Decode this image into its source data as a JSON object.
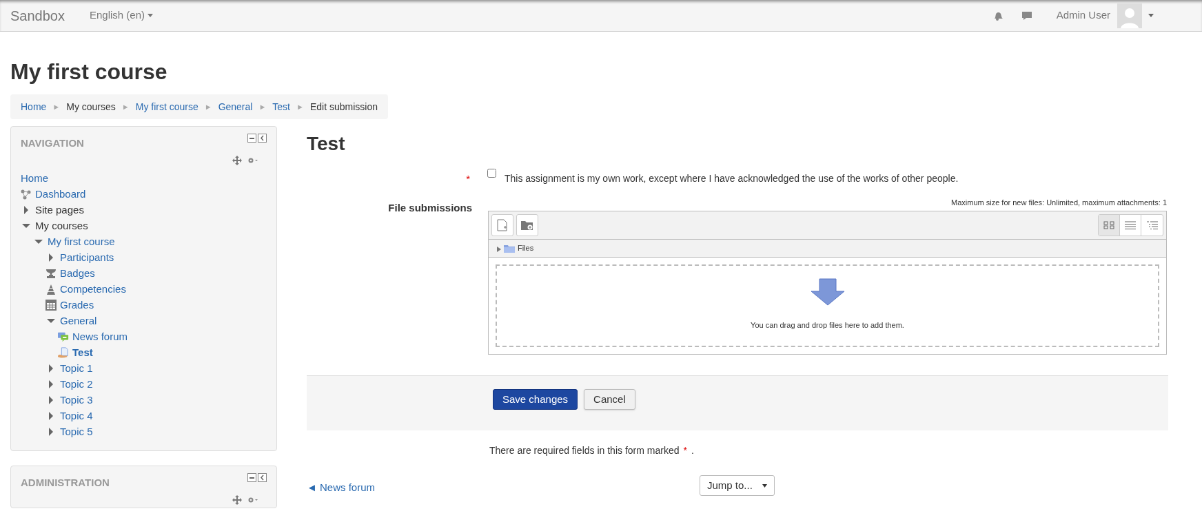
{
  "navbar": {
    "brand": "Sandbox",
    "language": "English (en)",
    "user_name": "Admin User"
  },
  "page_title": "My first course",
  "breadcrumb": [
    {
      "label": "Home",
      "kind": "link"
    },
    {
      "separator": "►",
      "label": "My courses",
      "kind": "text"
    },
    {
      "separator": "►",
      "label": "My first course",
      "kind": "link"
    },
    {
      "separator": "►",
      "label": "General",
      "kind": "link"
    },
    {
      "separator": "►",
      "label": "Test",
      "kind": "link"
    },
    {
      "separator": "►",
      "label": "Edit submission",
      "kind": "text"
    }
  ],
  "navigation": {
    "title": "NAVIGATION",
    "items": [
      {
        "label": "Home",
        "kind": "link",
        "selected": false
      },
      {
        "label": "Dashboard",
        "kind": "link",
        "selected": false
      },
      {
        "label": "Site pages",
        "kind": "text",
        "expanded": false,
        "selected": false
      },
      {
        "label": "My courses",
        "kind": "text",
        "expanded": true,
        "selected": false,
        "children": [
          {
            "label": "My first course",
            "kind": "link",
            "expanded": true,
            "selected": false,
            "children": [
              {
                "label": "Participants",
                "kind": "link",
                "expanded": false,
                "selected": false
              },
              {
                "label": "Badges",
                "kind": "link",
                "selected": false
              },
              {
                "label": "Competencies",
                "kind": "link",
                "selected": false
              },
              {
                "label": "Grades",
                "kind": "link",
                "selected": false
              },
              {
                "label": "General",
                "kind": "link",
                "expanded": true,
                "selected": false,
                "children": [
                  {
                    "label": "News forum",
                    "kind": "link",
                    "selected": false
                  },
                  {
                    "label": "Test",
                    "kind": "link",
                    "selected": true
                  }
                ]
              },
              {
                "label": "Topic 1",
                "kind": "link",
                "expanded": false,
                "selected": false
              },
              {
                "label": "Topic 2",
                "kind": "link",
                "expanded": false,
                "selected": false
              },
              {
                "label": "Topic 3",
                "kind": "link",
                "expanded": false,
                "selected": false
              },
              {
                "label": "Topic 4",
                "kind": "link",
                "expanded": false,
                "selected": false
              },
              {
                "label": "Topic 5",
                "kind": "link",
                "expanded": false,
                "selected": false
              }
            ]
          }
        ]
      }
    ]
  },
  "administration": {
    "title": "ADMINISTRATION"
  },
  "main": {
    "heading": "Test",
    "statement": {
      "required_mark": "*",
      "checked": false,
      "label": "This assignment is my own work, except where I have acknowledged the use of the works of other people."
    },
    "file_submissions": {
      "label": "File submissions",
      "limits": "Maximum size for new files: Unlimited, maximum attachments: 1",
      "folder": "Files",
      "drop_hint": "You can drag and drop files here to add them."
    },
    "buttons": [
      {
        "label": "Save changes",
        "kind": "primary"
      },
      {
        "label": "Cancel",
        "kind": "secondary"
      }
    ],
    "required_note": {
      "text": "There are required fields in this form marked",
      "mark": "*",
      "end": "."
    },
    "prev_link": "◄ News forum",
    "jump_select": {
      "value": "Jump to..."
    }
  }
}
